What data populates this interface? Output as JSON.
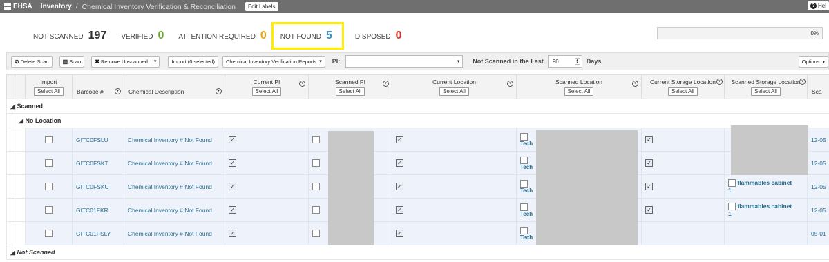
{
  "topbar": {
    "brand": "EHSA",
    "breadcrumb": "Inventory",
    "separator": "/",
    "title": "Chemical Inventory Verification & Reconciliation",
    "edit_labels": "Edit Labels",
    "help_label": "Hel"
  },
  "stats": {
    "not_scanned_label": "NOT SCANNED",
    "not_scanned_value": "197",
    "not_scanned_color": "#333333",
    "verified_label": "VERIFIED",
    "verified_value": "0",
    "verified_color": "#6aaa2a",
    "attention_label": "ATTENTION REQUIRED",
    "attention_value": "0",
    "attention_color": "#e8a317",
    "not_found_label": "NOT FOUND",
    "not_found_value": "5",
    "not_found_color": "#3a8fc4",
    "disposed_label": "DISPOSED",
    "disposed_value": "0",
    "disposed_color": "#d9342b"
  },
  "progress": {
    "text": "0%",
    "value_percent": 0
  },
  "toolbar": {
    "delete_scan": "Delete Scan",
    "scan": "Scan",
    "remove_unscanned": "Remove Unscanned",
    "import_selected": "Import (0 selected)",
    "reports": "Chemical Inventory Verification Reports",
    "pi_label": "PI:",
    "not_scanned_last_label": "Not Scanned in the Last",
    "days_value": "90",
    "days_label": "Days",
    "options": "Options"
  },
  "columns": {
    "import": "Import",
    "select_all": "Select All",
    "barcode": "Barcode #",
    "description": "Chemical Description",
    "current_pi": "Current PI",
    "scanned_pi": "Scanned PI",
    "current_location": "Current Location",
    "scanned_location": "Scanned Location",
    "current_storage": "Current Storage Location",
    "scanned_storage": "Scanned Storage Location",
    "scanned_date": "Sca"
  },
  "groups": {
    "scanned": "Scanned",
    "no_location": "No Location",
    "not_scanned": "Not Scanned"
  },
  "rows": [
    {
      "barcode": "GITC0FSLU",
      "description": "Chemical Inventory # Not Found",
      "loc_text": "Tech",
      "storage_text": "",
      "date": "12-05"
    },
    {
      "barcode": "GITC0FSKT",
      "description": "Chemical Inventory # Not Found",
      "loc_text": "Tech",
      "storage_text": "",
      "date": "12-05"
    },
    {
      "barcode": "GITC0FSKU",
      "description": "Chemical Inventory # Not Found",
      "loc_text": "Tech",
      "storage_text": "flammables cabinet",
      "storage_num": "1",
      "date": "12-05"
    },
    {
      "barcode": "GITC01FKR",
      "description": "Chemical Inventory # Not Found",
      "loc_text": "Tech",
      "storage_text": "flammables cabinet",
      "storage_num": "1",
      "date": "12-05"
    },
    {
      "barcode": "GITC01FSLY",
      "description": "Chemical Inventory # Not Found",
      "loc_text": "Tech",
      "storage_text": "",
      "date": "05-01"
    }
  ]
}
